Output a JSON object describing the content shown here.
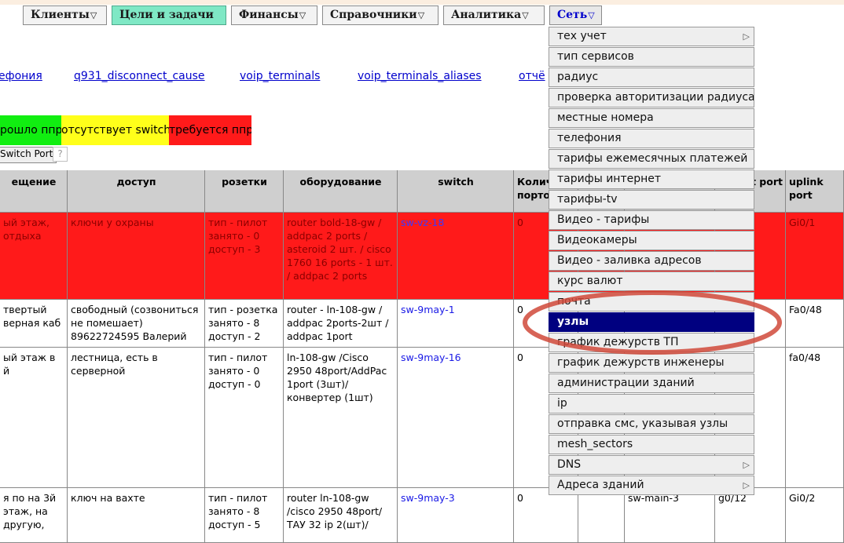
{
  "topmenu": [
    {
      "label": "Клиенты",
      "arrow": "▽"
    },
    {
      "label": "Цели и задачи",
      "arrow": ""
    },
    {
      "label": "Финансы",
      "arrow": "▽"
    },
    {
      "label": "Справочники",
      "arrow": "▽"
    },
    {
      "label": "Аналитика",
      "arrow": "▽"
    },
    {
      "label": "Сеть",
      "arrow": "▽"
    }
  ],
  "links": [
    "ефония",
    "q931_disconnect_cause",
    "voip_terminals",
    "voip_terminals_aliases",
    "отчё"
  ],
  "legend": {
    "green": "рошло ппр",
    "yellow": "отсутствует switch",
    "red": "требуется ппр",
    "switch_port_button": "Switch Port",
    "help_button": "?"
  },
  "colors": {
    "green": "#11ee11",
    "yellow": "#ffff1a",
    "red": "#ff1a1a",
    "selected": "#000080",
    "circle": "#d0493a"
  },
  "table": {
    "headers": [
      "ещение",
      "доступ",
      "розетки",
      "оборудование",
      "switch",
      "Колич портов",
      "",
      "",
      "t port",
      "uplink port"
    ],
    "rows": [
      {
        "status": "red",
        "cells": [
          "ый этаж, отдыха",
          "ключи у охраны",
          "тип - пилот занято - 0 доступ - 3",
          "router bold-18-gw / addpac 2 ports / asteroid 2 шт. / cisco 1760 16 ports - 1 шт. / addpac 2 ports",
          "sw-vz-18",
          "0",
          "",
          "",
          "",
          "Gi0/1"
        ]
      },
      {
        "status": "",
        "cells": [
          "твертый верная каб",
          "свободный (созвониться не помешает) 89622724595 Валерий",
          "тип - розетка занято - 8 доступ - 2",
          "router - ln-108-gw / addpac 2ports-2шт / addpac 1port",
          "sw-9may-1",
          "0",
          "",
          "",
          "",
          "Fa0/48"
        ]
      },
      {
        "status": "",
        "cells": [
          "ый этаж в й",
          "лестница, есть в серверной",
          "тип - пилот занято - 0 доступ - 0",
          "ln-108-gw /Cisco 2950 48port/AddPac 1port (3шт)/ конвертер (1шт)",
          "sw-9may-16",
          "0",
          "",
          "",
          "",
          "fa0/48"
        ]
      },
      {
        "status": "",
        "cells": [
          "я по на 3й этаж, на другую,",
          "ключ на вахте",
          "тип - пилот занято - 8 доступ - 5",
          "router ln-108-gw /cisco 2950 48port/ ТАУ 32 ip 2(шт)/",
          "sw-9may-3",
          "0",
          "",
          "sw-main-3",
          "g0/12",
          "Gi0/2"
        ]
      }
    ]
  },
  "dropdown": [
    {
      "label": "тех учет",
      "submenu": true
    },
    {
      "label": "тип сервисов",
      "submenu": false
    },
    {
      "label": "радиус",
      "submenu": false
    },
    {
      "label": "проверка авторитизации радиуса",
      "submenu": false
    },
    {
      "label": "местные номера",
      "submenu": false
    },
    {
      "label": "телефония",
      "submenu": false
    },
    {
      "label": "тарифы ежемесячных платежей",
      "submenu": false
    },
    {
      "label": "тарифы интернет",
      "submenu": false
    },
    {
      "label": "тарифы-tv",
      "submenu": false
    },
    {
      "label": "Видео - тарифы",
      "submenu": false
    },
    {
      "label": "Видеокамеры",
      "submenu": false
    },
    {
      "label": "Видео - заливка адресов",
      "submenu": false
    },
    {
      "label": "курс валют",
      "submenu": false
    },
    {
      "label": "почта",
      "submenu": false
    },
    {
      "label": "узлы",
      "submenu": false,
      "selected": true
    },
    {
      "label": "график дежурств ТП",
      "submenu": false
    },
    {
      "label": "график дежурств инженеры",
      "submenu": false
    },
    {
      "label": "администрации зданий",
      "submenu": false
    },
    {
      "label": "ip",
      "submenu": false
    },
    {
      "label": "отправка смс, указывая узлы",
      "submenu": false
    },
    {
      "label": "mesh_sectors",
      "submenu": false
    },
    {
      "label": "DNS",
      "submenu": true
    },
    {
      "label": "Адреса зданий",
      "submenu": true
    }
  ],
  "icons": {
    "submenu_arrow": "submenu-arrow-icon",
    "dropdown_arrow": "dropdown-arrow-icon"
  }
}
